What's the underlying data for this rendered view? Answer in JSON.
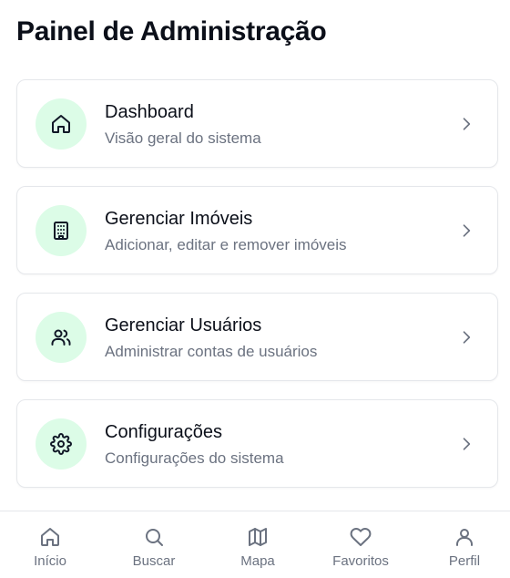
{
  "page": {
    "title": "Painel de Administração"
  },
  "menu": [
    {
      "title": "Dashboard",
      "subtitle": "Visão geral do sistema",
      "icon": "home-icon"
    },
    {
      "title": "Gerenciar Imóveis",
      "subtitle": "Adicionar, editar e remover imóveis",
      "icon": "building-icon"
    },
    {
      "title": "Gerenciar Usuários",
      "subtitle": "Administrar contas de usuários",
      "icon": "users-icon"
    },
    {
      "title": "Configurações",
      "subtitle": "Configurações do sistema",
      "icon": "gear-icon"
    }
  ],
  "nav": [
    {
      "label": "Início",
      "icon": "home-icon"
    },
    {
      "label": "Buscar",
      "icon": "search-icon"
    },
    {
      "label": "Mapa",
      "icon": "map-icon"
    },
    {
      "label": "Favoritos",
      "icon": "heart-icon"
    },
    {
      "label": "Perfil",
      "icon": "user-icon"
    }
  ],
  "colors": {
    "icon_circle_bg": "#dcfce7",
    "text_primary": "#0b0f19",
    "text_secondary": "#6b7280",
    "border": "#e5e7eb"
  }
}
